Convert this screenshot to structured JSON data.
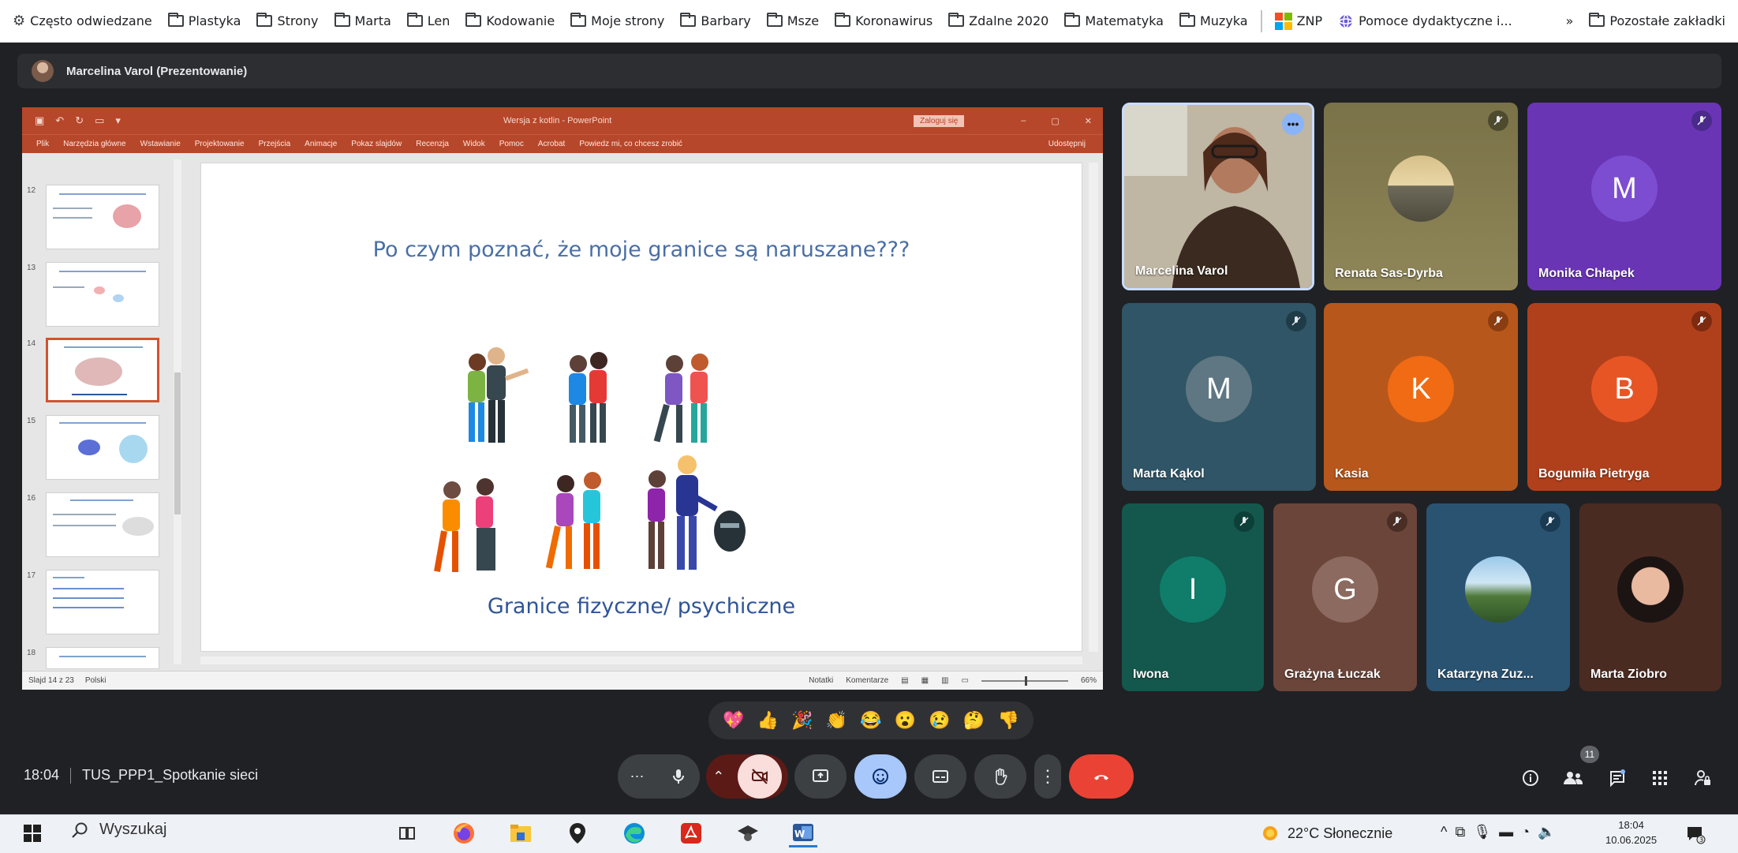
{
  "bookmarks": {
    "items": [
      {
        "label": "Często odwiedzane",
        "icon": "gear-icon"
      },
      {
        "label": "Plastyka",
        "icon": "folder-icon"
      },
      {
        "label": "Strony",
        "icon": "folder-icon"
      },
      {
        "label": "Marta",
        "icon": "folder-icon"
      },
      {
        "label": "Len",
        "icon": "folder-icon"
      },
      {
        "label": "Kodowanie",
        "icon": "folder-icon"
      },
      {
        "label": "Moje strony",
        "icon": "folder-icon"
      },
      {
        "label": "Barbary",
        "icon": "folder-icon"
      },
      {
        "label": "Msze",
        "icon": "folder-icon"
      },
      {
        "label": "Koronawirus",
        "icon": "folder-icon"
      },
      {
        "label": "Zdalne 2020",
        "icon": "folder-icon"
      },
      {
        "label": "Matematyka",
        "icon": "folder-icon"
      },
      {
        "label": "Muzyka",
        "icon": "folder-icon"
      },
      {
        "label": "ZNP",
        "icon": "znp-icon"
      },
      {
        "label": "Pomoce dydaktyczne i...",
        "icon": "globe-icon"
      }
    ],
    "overflow": "»",
    "other": "Pozostałe zakładki"
  },
  "presenter": {
    "name": "Marcelina Varol (Prezentowanie)"
  },
  "ppt": {
    "doc_title": "Wersja z kotlin - PowerPoint",
    "signin": "Zaloguj się",
    "ribbon_tabs": [
      "Plik",
      "Narzędzia główne",
      "Wstawianie",
      "Projektowanie",
      "Przejścia",
      "Animacje",
      "Pokaz slajdów",
      "Recenzja",
      "Widok",
      "Pomoc",
      "Acrobat",
      "Powiedz mi, co chcesz zrobić"
    ],
    "share": "Udostępnij",
    "thumb_numbers": [
      "12",
      "13",
      "14",
      "15",
      "16",
      "17",
      "18"
    ],
    "slide_title": "Po czym poznać, że moje granice są naruszane???",
    "slide_caption": "Granice fizyczne/ psychiczne",
    "status_left": "Slajd 14 z 23",
    "status_lang": "Polski",
    "status_notes": "Notatki",
    "status_comments": "Komentarze",
    "zoom": "66%"
  },
  "participants": [
    {
      "name": "Marcelina Varol",
      "type": "video",
      "bg": "#6b4e3a"
    },
    {
      "name": "Renata Sas-Dyrba",
      "type": "photo",
      "bg": "#8a7c4a"
    },
    {
      "name": "Monika Chłapek",
      "initial": "M",
      "bg": "#6a35b5",
      "avatar": "#7c4dd1"
    },
    {
      "name": "Marta Kąkol",
      "initial": "M",
      "bg": "#2f5566",
      "avatar": "#5f7782"
    },
    {
      "name": "Kasia",
      "initial": "K",
      "bg": "#b8571b",
      "avatar": "#f06b14"
    },
    {
      "name": "Bogumiła Pietryga",
      "initial": "B",
      "bg": "#b0401c",
      "avatar": "#e85525"
    },
    {
      "name": "Iwona",
      "initial": "I",
      "bg": "#14574d",
      "avatar": "#0f7d6a"
    },
    {
      "name": "Grażyna Łuczak",
      "initial": "G",
      "bg": "#6b4539",
      "avatar": "#8c6a60"
    },
    {
      "name": "Katarzyna Zuz...",
      "type": "photo",
      "bg": "#2a5372"
    },
    {
      "name": "Marta Ziobro",
      "type": "photo",
      "bg": "#4a2b22"
    }
  ],
  "reactions": [
    "💖",
    "👍",
    "🎉",
    "👏",
    "😂",
    "😮",
    "😢",
    "🤔",
    "👎"
  ],
  "meeting": {
    "time": "18:04",
    "title": "TUS_PPP1_Spotkanie sieci",
    "people_count": "11"
  },
  "taskbar": {
    "search_placeholder": "Wyszukaj",
    "weather": "22°C Słonecznie",
    "time": "18:04",
    "date": "10.06.2025",
    "notif_count": "3"
  },
  "colors": {
    "meet_bg": "#202124",
    "ppt_accent": "#b7472a",
    "hangup": "#ea4335",
    "emoji_active": "#8ab4f8"
  }
}
